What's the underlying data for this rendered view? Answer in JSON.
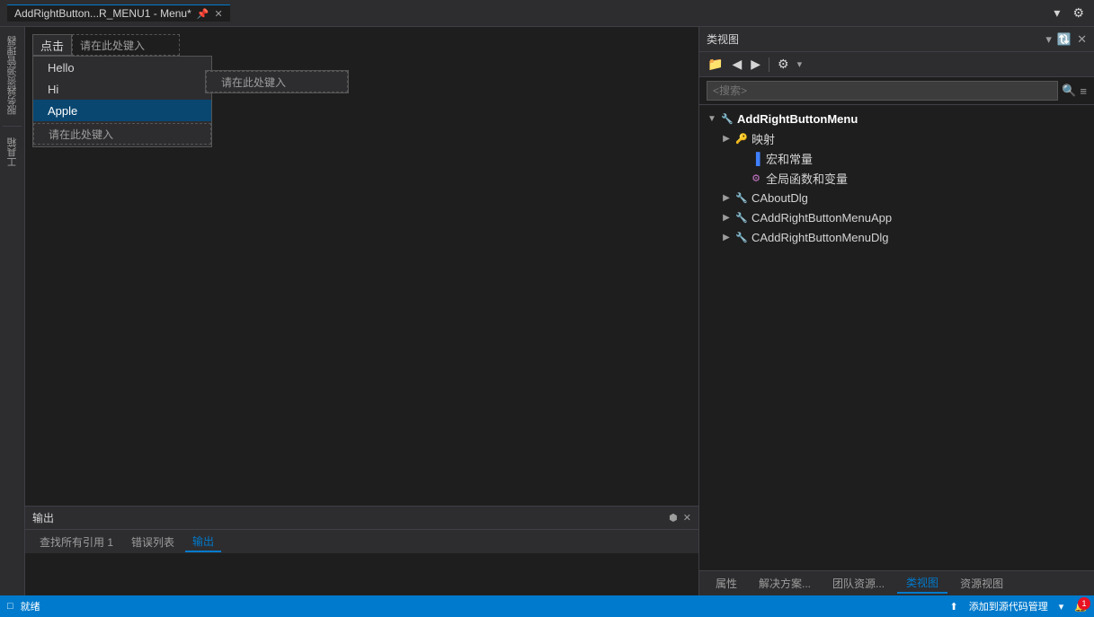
{
  "window": {
    "title": "AddRightButton...R_MENU1 - Menu*",
    "pin_label": "📌",
    "close_label": "✕"
  },
  "toolbar": {
    "dropdown_icon": "▾",
    "settings_icon": "⚙"
  },
  "menu_editor": {
    "click_label": "点击",
    "placeholder1": "请在此处键入",
    "placeholder2": "请在此处键入",
    "placeholder3": "请在此处键入",
    "items": [
      {
        "label": "Hello"
      },
      {
        "label": "Hi"
      },
      {
        "label": "Apple",
        "selected": true
      }
    ]
  },
  "output_panel": {
    "title": "输出",
    "pin_icon": "⬢",
    "close_icon": "✕",
    "tabs": [
      {
        "label": "查找所有引用 1"
      },
      {
        "label": "错误列表"
      },
      {
        "label": "输出",
        "active": true
      }
    ]
  },
  "class_view": {
    "title": "类视图",
    "pin_icon": "🔃",
    "close_icon": "✕",
    "dropdown_icon": "▾",
    "search_placeholder": "<搜索>",
    "search_icon": "🔍",
    "menu_icon": "≡",
    "toolbar": {
      "folder_icon": "📁",
      "back_icon": "◀",
      "forward_icon": "▶",
      "settings_icon": "⚙"
    },
    "tree": {
      "root": {
        "label": "AddRightButtonMenu",
        "expanded": true,
        "children": [
          {
            "label": "映射",
            "icon": "🔑",
            "indent": 1,
            "has_expand": true
          },
          {
            "label": "宏和常量",
            "icon": "▐",
            "indent": 2,
            "has_expand": false
          },
          {
            "label": "全局函数和变量",
            "icon": "⚙",
            "indent": 2,
            "has_expand": false
          },
          {
            "label": "CAboutDlg",
            "icon": "🔧",
            "indent": 1,
            "has_expand": true
          },
          {
            "label": "CAddRightButtonMenuApp",
            "icon": "🔧",
            "indent": 1,
            "has_expand": true
          },
          {
            "label": "CAddRightButtonMenuDlg",
            "icon": "🔧",
            "indent": 1,
            "has_expand": true
          }
        ]
      }
    }
  },
  "bottom_tabs": {
    "items": [
      {
        "label": "属性"
      },
      {
        "label": "解决方案..."
      },
      {
        "label": "团队资源..."
      },
      {
        "label": "类视图",
        "active": true
      },
      {
        "label": "资源视图"
      }
    ]
  },
  "status_bar": {
    "status": "就绪",
    "source_control": "添加到源代码管理",
    "dropdown_icon": "▾",
    "notification_count": "1"
  },
  "left_sidebar": {
    "items": [
      {
        "label": "服务器资源管理器"
      },
      {
        "label": "工具箱"
      }
    ]
  }
}
